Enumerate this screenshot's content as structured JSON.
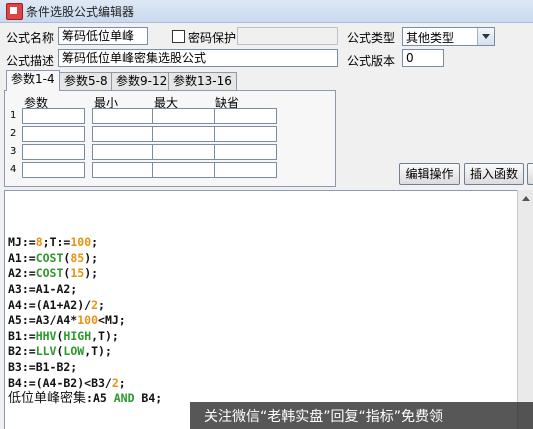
{
  "window": {
    "title": "条件选股公式编辑器"
  },
  "form": {
    "name_label": "公式名称",
    "name_value": "筹码低位单峰",
    "password_label": "密码保护",
    "type_label": "公式类型",
    "type_value": "其他类型",
    "desc_label": "公式描述",
    "desc_value": "筹码低位单峰密集选股公式",
    "version_label": "公式版本",
    "version_value": "0"
  },
  "tabs": [
    "参数1-4",
    "参数5-8",
    "参数9-12",
    "参数13-16"
  ],
  "params": {
    "headers": [
      "参数",
      "最小",
      "最大",
      "缺省"
    ],
    "rows": [
      "1",
      "2",
      "3",
      "4"
    ]
  },
  "buttons": {
    "edit_ops": "编辑操作",
    "insert_func": "插入函数"
  },
  "code": [
    [
      [
        "MJ:=",
        ""
      ],
      [
        "8",
        "num"
      ],
      [
        ";T:=",
        ""
      ],
      [
        "100",
        "num"
      ],
      [
        ";",
        ""
      ]
    ],
    [
      [
        "A1:=",
        ""
      ],
      [
        "COST",
        "fn"
      ],
      [
        "(",
        ""
      ],
      [
        "85",
        "num"
      ],
      [
        ");",
        ""
      ]
    ],
    [
      [
        "A2:=",
        ""
      ],
      [
        "COST",
        "fn"
      ],
      [
        "(",
        ""
      ],
      [
        "15",
        "num"
      ],
      [
        ");",
        ""
      ]
    ],
    [
      [
        "A3:=A1-A2;",
        ""
      ]
    ],
    [
      [
        "A4:=(A1+A2)/",
        ""
      ],
      [
        "2",
        "num"
      ],
      [
        ";",
        ""
      ]
    ],
    [
      [
        "A5:=A3/A4*",
        ""
      ],
      [
        "100",
        "num"
      ],
      [
        "<MJ;",
        ""
      ]
    ],
    [
      [
        "B1:=",
        ""
      ],
      [
        "HHV",
        "fn"
      ],
      [
        "(",
        ""
      ],
      [
        "HIGH",
        "fn"
      ],
      [
        ",T);",
        ""
      ]
    ],
    [
      [
        "B2:=",
        ""
      ],
      [
        "LLV",
        "fn"
      ],
      [
        "(",
        ""
      ],
      [
        "LOW",
        "fn"
      ],
      [
        ",T);",
        ""
      ]
    ],
    [
      [
        "B3:=B1-B2;",
        ""
      ]
    ],
    [
      [
        "B4:=(A4-B2)<B3/",
        ""
      ],
      [
        "2",
        "num"
      ],
      [
        ";",
        ""
      ]
    ]
  ],
  "code_last": {
    "cjk": "低位单峰密集",
    "rest1": ":A5 ",
    "kw": "AND",
    "rest2": " B4;"
  },
  "watermark": "关注微信“老韩实盘”回复“指标”免费领"
}
